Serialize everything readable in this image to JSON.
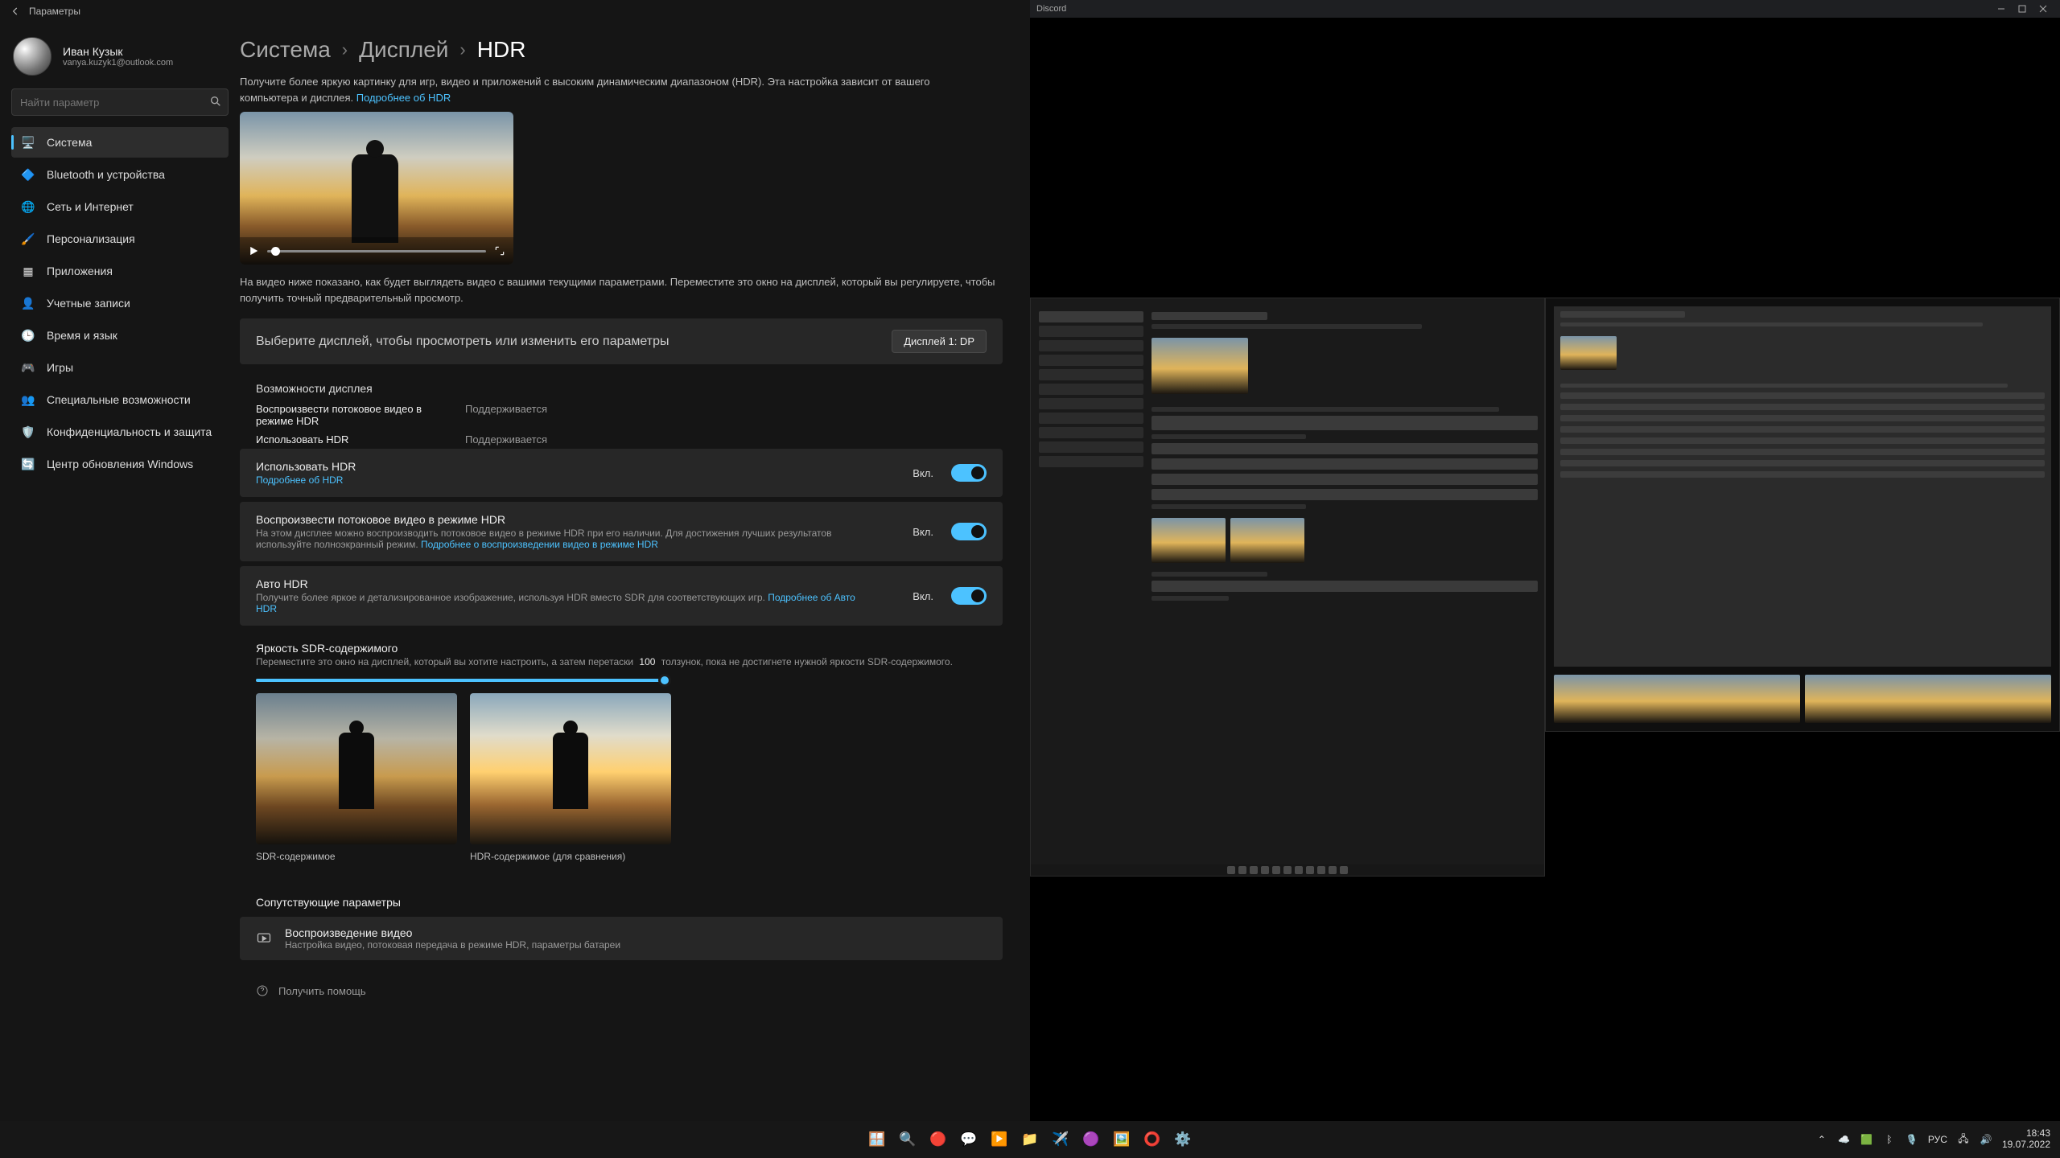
{
  "titlebar": {
    "title": "Параметры"
  },
  "user": {
    "name": "Иван Кузык",
    "email": "vanya.kuzyk1@outlook.com"
  },
  "search": {
    "placeholder": "Найти параметр"
  },
  "nav": [
    {
      "key": "system",
      "label": "Система",
      "icon": "🖥️",
      "active": true
    },
    {
      "key": "bluetooth",
      "label": "Bluetooth и устройства",
      "icon": "📶"
    },
    {
      "key": "network",
      "label": "Сеть и Интернет",
      "icon": "🌐"
    },
    {
      "key": "personal",
      "label": "Персонализация",
      "icon": "🎨"
    },
    {
      "key": "apps",
      "label": "Приложения",
      "icon": "▦"
    },
    {
      "key": "accounts",
      "label": "Учетные записи",
      "icon": "👤"
    },
    {
      "key": "timelang",
      "label": "Время и язык",
      "icon": "🕒"
    },
    {
      "key": "gaming",
      "label": "Игры",
      "icon": "🎮"
    },
    {
      "key": "access",
      "label": "Специальные возможности",
      "icon": "♿"
    },
    {
      "key": "privacy",
      "label": "Конфиденциальность и защита",
      "icon": "🛡️"
    },
    {
      "key": "update",
      "label": "Центр обновления Windows",
      "icon": "🔄"
    }
  ],
  "breadcrumb": {
    "root": "Система",
    "mid": "Дисплей",
    "leaf": "HDR"
  },
  "intro": {
    "text": "Получите более яркую картинку для игр, видео и приложений с высоким динамическим диапазоном (HDR). Эта настройка зависит от вашего компьютера и дисплея. ",
    "link": "Подробнее об HDR"
  },
  "preview_caption": "На видео ниже показано, как будет выглядеть видео с вашими текущими параметрами. Переместите это окно на дисплей, который вы регулируете, чтобы получить точный предварительный просмотр.",
  "select_display": {
    "label": "Выберите дисплей, чтобы просмотреть или изменить его параметры",
    "value": "Дисплей 1: DP"
  },
  "capabilities": {
    "heading": "Возможности дисплея",
    "rows": [
      {
        "k": "Воспроизвести потоковое видео в режиме HDR",
        "v": "Поддерживается"
      },
      {
        "k": "Использовать HDR",
        "v": "Поддерживается"
      }
    ]
  },
  "toggles": {
    "use_hdr": {
      "title": "Использовать HDR",
      "sub": "Подробнее об HDR",
      "state": "Вкл."
    },
    "stream_hdr": {
      "title": "Воспроизвести потоковое видео в режиме HDR",
      "sub": "На этом дисплее можно воспроизводить потоковое видео в режиме HDR при его наличии. Для достижения лучших результатов используйте полноэкранный режим. ",
      "link": "Подробнее о воспроизведении видео в режиме HDR",
      "state": "Вкл."
    },
    "auto_hdr": {
      "title": "Авто HDR",
      "sub": "Получите более яркое и детализированное изображение, используя HDR вместо SDR для соответствующих игр. ",
      "link": "Подробнее об Авто HDR",
      "state": "Вкл."
    }
  },
  "sdr": {
    "title": "Яркость SDR-содержимого",
    "sub_pre": "Переместите это окно на дисплей, который вы хотите настроить, а затем перетаски",
    "value": "100",
    "sub_post": "толзунок, пока не достигнете нужной яркости SDR-содержимого.",
    "labels": {
      "sdr": "SDR-содержимое",
      "hdr": "HDR-содержимое (для сравнения)"
    }
  },
  "related": {
    "heading": "Сопутствующие параметры",
    "item": {
      "title": "Воспроизведение видео",
      "sub": "Настройка видео, потоковая передача в режиме HDR, параметры батареи"
    }
  },
  "help": "Получить помощь",
  "discord": {
    "title": "Discord"
  },
  "tray": {
    "lang": "РУС",
    "time": "18:43",
    "date": "19.07.2022"
  }
}
